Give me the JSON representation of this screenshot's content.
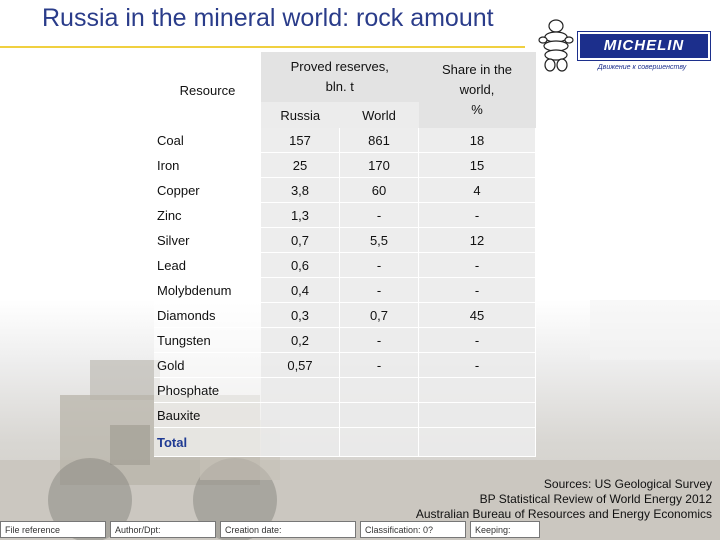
{
  "title": "Russia in the mineral world: rock amount",
  "logo": {
    "brand": "MICHELIN",
    "tagline": "Движение к совершенству"
  },
  "table": {
    "header_resource": "Resource",
    "header_reserves_line1": "Proved reserves,",
    "header_reserves_line2": "bln. t",
    "header_share_line1": "Share in the",
    "header_share_line2": "world,",
    "header_share_line3": "%",
    "sub_russia": "Russia",
    "sub_world": "World",
    "rows": [
      {
        "name": "Coal",
        "russia": "157",
        "world": "861",
        "share": "18"
      },
      {
        "name": "Iron",
        "russia": "25",
        "world": "170",
        "share": "15"
      },
      {
        "name": "Copper",
        "russia": "3,8",
        "world": "60",
        "share": "4"
      },
      {
        "name": "Zinc",
        "russia": "1,3",
        "world": "-",
        "share": "-"
      },
      {
        "name": "Silver",
        "russia": "0,7",
        "world": "5,5",
        "share": "12"
      },
      {
        "name": "Lead",
        "russia": "0,6",
        "world": "-",
        "share": "-"
      },
      {
        "name": "Molybdenum",
        "russia": "0,4",
        "world": "-",
        "share": "-"
      },
      {
        "name": "Diamonds",
        "russia": "0,3",
        "world": "0,7",
        "share": "45"
      },
      {
        "name": "Tungsten",
        "russia": "0,2",
        "world": "-",
        "share": "-"
      },
      {
        "name": "Gold",
        "russia": "0,57",
        "world": "-",
        "share": "-"
      },
      {
        "name": "Phosphate",
        "russia": "",
        "world": "",
        "share": ""
      },
      {
        "name": "Bauxite",
        "russia": "",
        "world": "",
        "share": ""
      }
    ],
    "total_label": "Total"
  },
  "sources": [
    "Sources: US Geological Survey",
    "BP Statistical Review of World Energy 2012",
    "Australian Bureau of Resources and Energy Economics"
  ],
  "footer": {
    "file_reference": "File reference",
    "author": "Author/Dpt:",
    "creation_date": "Creation date:",
    "classification": "Classification: 0?",
    "keeping": "Keeping:"
  },
  "colors": {
    "title": "#2a3c8a",
    "rule": "#f0d040",
    "brand": "#1c2f8c",
    "total": "#1f3a93"
  }
}
